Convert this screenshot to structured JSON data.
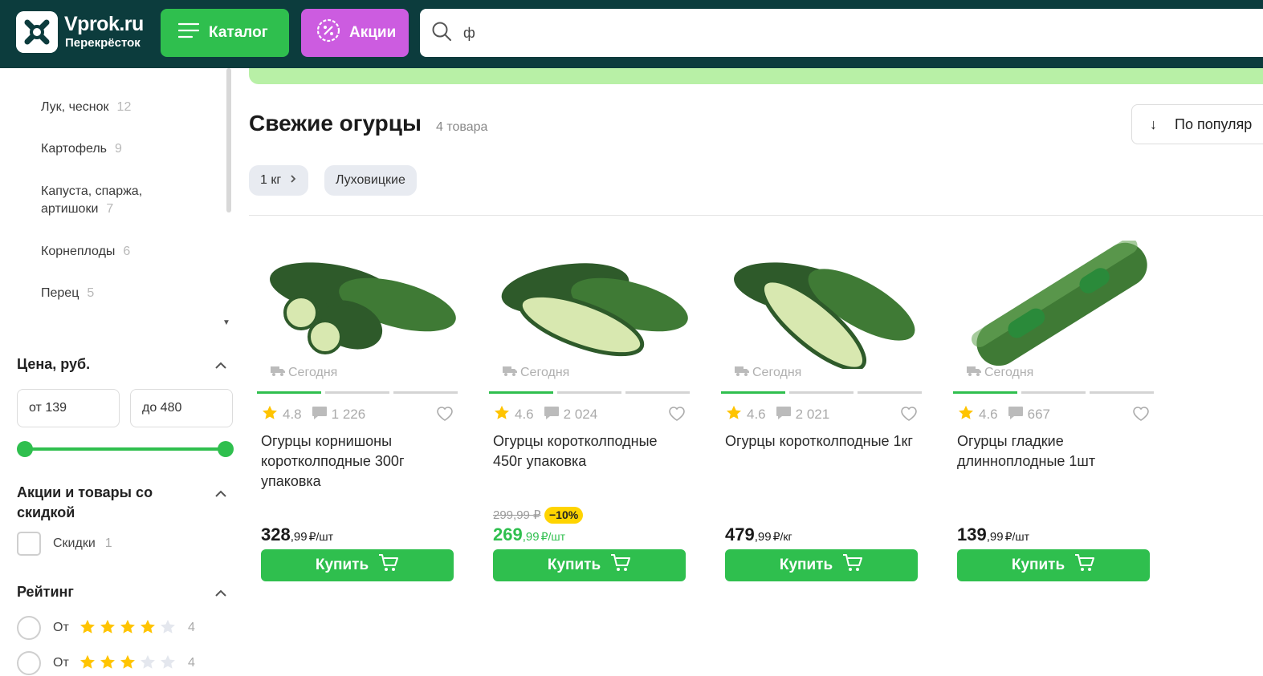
{
  "header": {
    "logo_title": "Vprok.ru",
    "logo_subtitle": "Перекрёсток",
    "catalog_label": "Каталог",
    "promo_label": "Акции",
    "search_value": "ф"
  },
  "sidebar": {
    "categories": [
      {
        "label": "Лук, чеснок",
        "count": "12"
      },
      {
        "label": "Картофель",
        "count": "9"
      },
      {
        "label": "Капуста, спаржа,",
        "label2": "артишоки",
        "count": "7"
      },
      {
        "label": "Корнеплоды",
        "count": "6"
      },
      {
        "label": "Перец",
        "count": "5"
      }
    ],
    "price_title": "Цена, руб.",
    "price_from": "от 139",
    "price_to": "до 480",
    "promo_title_1": "Акции и товары со",
    "promo_title_2": "скидкой",
    "discount_label": "Скидки",
    "discount_count": "1",
    "rating_title": "Рейтинг",
    "ratings": [
      {
        "label": "От",
        "stars": 4,
        "count": "4"
      },
      {
        "label": "От",
        "stars": 3,
        "count": "4"
      }
    ]
  },
  "main": {
    "title": "Свежие огурцы",
    "count": "4 товара",
    "sort_label": "По популяр",
    "chips": [
      "1 кг",
      "Луховицкие"
    ]
  },
  "products": [
    {
      "delivery": "Сегодня",
      "rating": "4.8",
      "reviews": "1 226",
      "name": "Огурцы корнишоны коротколподные 300г упаковка",
      "price": "328",
      "kop": ",99",
      "unit": "₽/шт",
      "old_price": "",
      "discount": "",
      "buy": "Купить"
    },
    {
      "delivery": "Сегодня",
      "rating": "4.6",
      "reviews": "2 024",
      "name": "Огурцы коротколподные 450г упаковка",
      "price": "269",
      "kop": ",99",
      "unit": "₽/шт",
      "old_price": "299,99 ₽",
      "discount": "−10%",
      "buy": "Купить"
    },
    {
      "delivery": "Сегодня",
      "rating": "4.6",
      "reviews": "2 021",
      "name": "Огурцы коротколподные 1кг",
      "price": "479",
      "kop": ",99",
      "unit": "₽/кг",
      "old_price": "",
      "discount": "",
      "buy": "Купить"
    },
    {
      "delivery": "Сегодня",
      "rating": "4.6",
      "reviews": "667",
      "name": "Огурцы гладкие длинноплодные 1шт",
      "price": "139",
      "kop": ",99",
      "unit": "₽/шт",
      "old_price": "",
      "discount": "",
      "buy": "Купить"
    }
  ],
  "colors": {
    "header_bg": "#0c3c3d",
    "accent_green": "#2fbf4e",
    "promo_purple": "#cc5ce0",
    "star": "#ffc400",
    "discount_badge": "#ffd400"
  }
}
